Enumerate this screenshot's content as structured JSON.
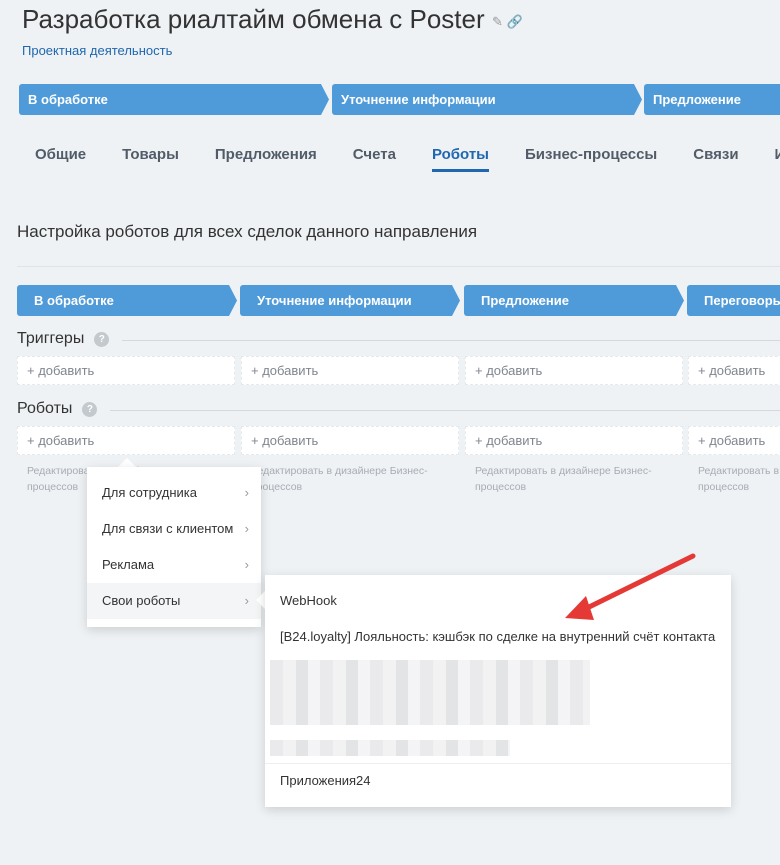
{
  "header": {
    "title": "Разработка риалтайм обмена с Poster",
    "category": "Проектная деятельность",
    "icons": [
      "pencil-icon",
      "link-icon"
    ]
  },
  "top_stages": [
    "В обработке",
    "Уточнение информации",
    "Предложение"
  ],
  "tabs": [
    {
      "label": "Общие"
    },
    {
      "label": "Товары"
    },
    {
      "label": "Предложения"
    },
    {
      "label": "Счета"
    },
    {
      "label": "Роботы",
      "active": true
    },
    {
      "label": "Бизнес-процессы"
    },
    {
      "label": "Связи"
    },
    {
      "label": "Ис"
    }
  ],
  "robots_page": {
    "heading": "Настройка роботов для всех сделок данного направления",
    "stages": [
      "В обработке",
      "Уточнение информации",
      "Предложение",
      "Переговоры"
    ],
    "triggers_label": "Триггеры",
    "robots_label": "Роботы",
    "help": "?",
    "add_label": "+ добавить",
    "desc_line1": "Редактировать в дизайнере Бизнес-",
    "desc_line2": "процессов"
  },
  "menu": {
    "items": [
      {
        "label": "Для сотрудника"
      },
      {
        "label": "Для связи с клиентом"
      },
      {
        "label": "Реклама"
      },
      {
        "label": "Свои роботы",
        "highlighted": true
      }
    ],
    "chevron": "›"
  },
  "submenu": {
    "items": [
      "WebHook",
      "[B24.loyalty] Лояльность: кэшбэк по сделке на внутренний счёт контакта"
    ],
    "footer": "Приложения24"
  },
  "colors": {
    "stage": "#4f9ad8",
    "accent": "#2067b0",
    "arrow": "#e53935",
    "background": "#eef2f4"
  }
}
